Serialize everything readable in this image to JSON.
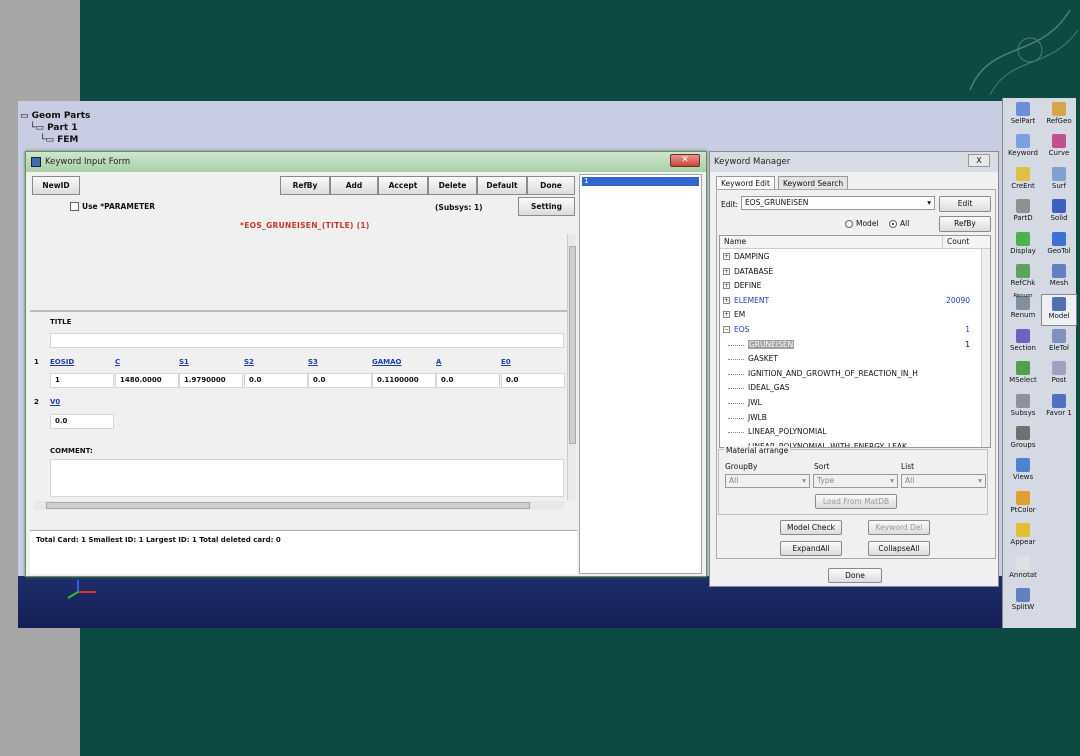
{
  "tree": [
    "Geom Parts",
    "Part 1",
    "FEM"
  ],
  "kif": {
    "title": "Keyword Input Form",
    "close": "✕",
    "buttons": {
      "newid": "NewID",
      "refby": "RefBy",
      "add": "Add",
      "accept": "Accept",
      "delete": "Delete",
      "default": "Default",
      "done": "Done",
      "setting": "Setting"
    },
    "use_parameter": "Use *PARAMETER",
    "subsys": "(Subsys: 1)",
    "keyword_title": "*EOS_GRUNEISEN_(TITLE)  (1)",
    "title_label": "TITLE",
    "card1": {
      "num": "1",
      "headers": [
        "EOSID",
        "C",
        "S1",
        "S2",
        "S3",
        "GAMAO",
        "A",
        "E0"
      ],
      "values": [
        "1",
        "1480.0000",
        "1.9790000",
        "0.0",
        "0.0",
        "0.1100000",
        "0.0",
        "0.0"
      ]
    },
    "card2": {
      "num": "2",
      "header": "V0",
      "value": "0.0"
    },
    "comment_label": "COMMENT:",
    "status": "Total Card: 1    Smallest ID: 1    Largest ID: 1    Total deleted card:  0",
    "side_selected": "1"
  },
  "km": {
    "title": "Keyword Manager",
    "close": "X",
    "tabs": [
      "Keyword Edit",
      "Keyword Search"
    ],
    "edit_label": "Edit:",
    "edit_value": "EOS_GRUNEISEN",
    "edit_button": "Edit",
    "radio_model": "Model",
    "radio_all": "All",
    "refby": "RefBy",
    "col_name": "Name",
    "col_count": "Count",
    "rows": [
      {
        "name": "DAMPING",
        "count": "",
        "exp": "+"
      },
      {
        "name": "DATABASE",
        "count": "",
        "exp": "+"
      },
      {
        "name": "DEFINE",
        "count": "",
        "exp": "+"
      },
      {
        "name": "ELEMENT",
        "count": "20090",
        "exp": "+"
      },
      {
        "name": "EM",
        "count": "",
        "exp": "+"
      },
      {
        "name": "EOS",
        "count": "1",
        "exp": "−"
      },
      {
        "name": "GRUNEISEN",
        "count": "1"
      },
      {
        "name": "GASKET",
        "count": ""
      },
      {
        "name": "IGNITION_AND_GROWTH_OF_REACTION_IN_H",
        "count": ""
      },
      {
        "name": "IDEAL_GAS",
        "count": ""
      },
      {
        "name": "JWL",
        "count": ""
      },
      {
        "name": "JWLB",
        "count": ""
      },
      {
        "name": "LINEAR_POLYNOMIAL",
        "count": ""
      },
      {
        "name": "LINEAR_POLYNOMIAL_WITH_ENERGY_LEAK",
        "count": ""
      }
    ],
    "material_arrange": "Material arrange",
    "groupby": "GroupBy",
    "sort": "Sort",
    "list": "List",
    "groupby_value": "All",
    "sort_value": "Type",
    "list_value": "All",
    "load_matdb": "Load From MatDB",
    "model_check": "Model Check",
    "keyword_del": "Keyword Del",
    "expand_all": "ExpandAll",
    "collapse_all": "CollapseAll",
    "done": "Done"
  },
  "toolbar": [
    "SelPart",
    "RefGeo",
    "Keyword",
    "Curve",
    "CreEnt",
    "Surf",
    "PartD",
    "Solid",
    "Display",
    "GeoTol",
    "RefChk",
    "Mesh",
    "Renum",
    "Model",
    "Section",
    "EleTol",
    "MSelect",
    "Post",
    "Subsys",
    "Favor 1",
    "Groups",
    "",
    "Views",
    "",
    "PtColor",
    "",
    "Appear",
    "",
    "Annotat",
    "",
    "SplitW",
    ""
  ],
  "toolbar_sublabel": "Renum",
  "toolbar_active": "Model"
}
